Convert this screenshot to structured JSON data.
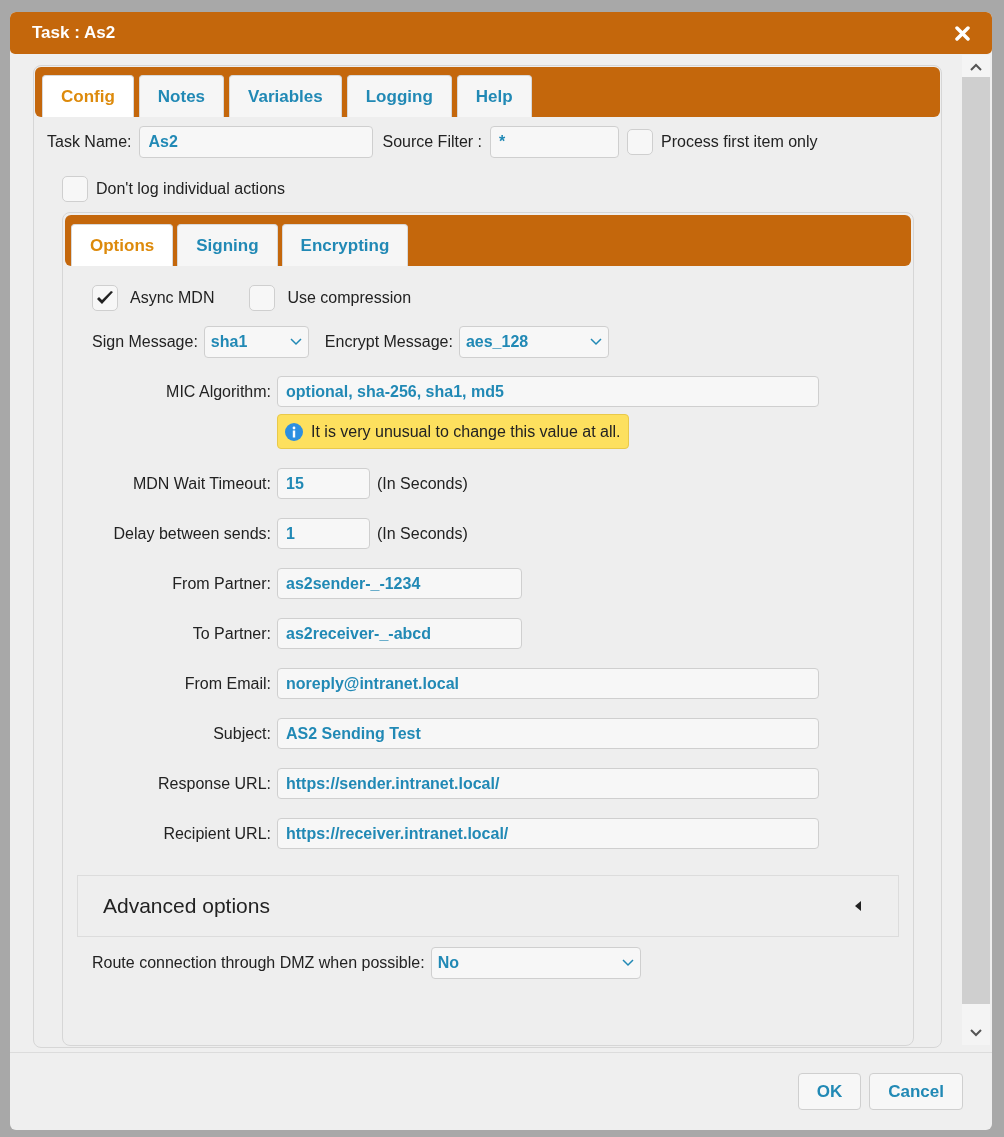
{
  "dialog": {
    "title": "Task : As2"
  },
  "tabs": [
    {
      "label": "Config",
      "selected": true
    },
    {
      "label": "Notes",
      "selected": false
    },
    {
      "label": "Variables",
      "selected": false
    },
    {
      "label": "Logging",
      "selected": false
    },
    {
      "label": "Help",
      "selected": false
    }
  ],
  "task_name": {
    "label": "Task Name:",
    "value": "As2"
  },
  "source_filter": {
    "label": "Source Filter :",
    "value": "*"
  },
  "process_first": {
    "label": "Process first item only",
    "checked": false
  },
  "dont_log": {
    "label": "Don't log individual actions",
    "checked": false
  },
  "sub_tabs": [
    {
      "label": "Options",
      "selected": true
    },
    {
      "label": "Signing",
      "selected": false
    },
    {
      "label": "Encrypting",
      "selected": false
    }
  ],
  "options": {
    "checks": [
      {
        "label": "Async MDN",
        "checked": true
      },
      {
        "label": "Use compression",
        "checked": false
      }
    ],
    "sign_message": {
      "label": "Sign Message:",
      "value": "sha1"
    },
    "encrypt_message": {
      "label": "Encrypt Message:",
      "value": "aes_128"
    },
    "fields": [
      {
        "label": "MIC Algorithm:",
        "value": "optional, sha-256, sha1, md5",
        "kind": "wide",
        "note": "It is very unusual to change this value at all."
      },
      {
        "label": "MDN Wait Timeout:",
        "value": "15",
        "kind": "short",
        "suffix": "(In Seconds)"
      },
      {
        "label": "Delay between sends:",
        "value": "1",
        "kind": "short",
        "suffix": "(In Seconds)"
      },
      {
        "label": "From Partner:",
        "value": "as2sender-_-1234",
        "kind": "medium"
      },
      {
        "label": "To Partner:",
        "value": "as2receiver-_-abcd",
        "kind": "medium"
      },
      {
        "label": "From Email:",
        "value": "noreply@intranet.local",
        "kind": "wide"
      },
      {
        "label": "Subject:",
        "value": "AS2 Sending Test",
        "kind": "wide"
      },
      {
        "label": "Response URL:",
        "value": "https://sender.intranet.local/",
        "kind": "wide"
      },
      {
        "label": "Recipient URL:",
        "value": "https://receiver.intranet.local/",
        "kind": "wide"
      }
    ]
  },
  "advanced": {
    "title": "Advanced options",
    "expanded": false
  },
  "dmz": {
    "label": "Route connection through DMZ when possible:",
    "value": "No"
  },
  "buttons": [
    "OK",
    "Cancel"
  ]
}
